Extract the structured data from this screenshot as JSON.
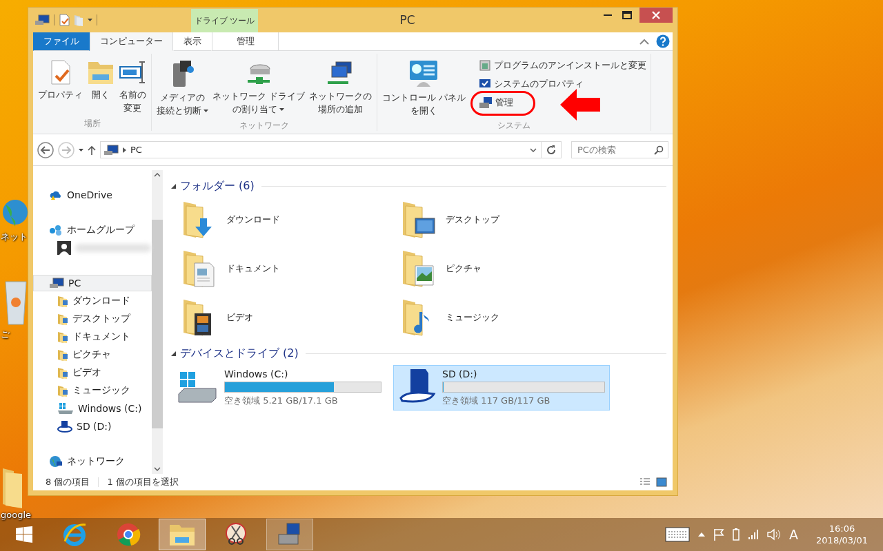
{
  "desktop_icons": [
    {
      "label": "ネット"
    },
    {
      "label": "ご"
    },
    {
      "label": "google"
    }
  ],
  "window": {
    "title": "PC",
    "contextual_group": "ドライブ ツール"
  },
  "tabs": [
    {
      "label": "ファイル",
      "kind": "file",
      "selected": false
    },
    {
      "label": "コンピューター",
      "kind": "normal",
      "selected": true
    },
    {
      "label": "表示",
      "kind": "normal",
      "selected": false
    },
    {
      "label": "管理",
      "kind": "contextual",
      "selected": false
    }
  ],
  "ribbon": {
    "groups": [
      {
        "label": "場所",
        "large": [
          {
            "lines": [
              "プロパティ"
            ],
            "dropdown": false
          },
          {
            "lines": [
              "開く"
            ],
            "dropdown": false
          },
          {
            "lines": [
              "名前の",
              "変更"
            ],
            "dropdown": false
          }
        ]
      },
      {
        "label": "ネットワーク",
        "large": [
          {
            "lines": [
              "メディアの",
              "接続と切断"
            ],
            "dropdown": true
          },
          {
            "lines": [
              "ネットワーク ドライブ",
              "の割り当て"
            ],
            "dropdown": true
          },
          {
            "lines": [
              "ネットワークの",
              "場所の追加"
            ],
            "dropdown": false
          }
        ]
      },
      {
        "label": "システム",
        "large": [
          {
            "lines": [
              "コントロール パネル",
              "を開く"
            ],
            "dropdown": false
          }
        ],
        "small": [
          {
            "label": "プログラムのアンインストールと変更",
            "highlighted": false
          },
          {
            "label": "システムのプロパティ",
            "highlighted": false
          },
          {
            "label": "管理",
            "highlighted": true
          }
        ]
      }
    ]
  },
  "address": {
    "path": "PC",
    "search_placeholder": "PCの検索"
  },
  "nav": {
    "items": [
      {
        "kind": "item",
        "label": "OneDrive",
        "selected": false
      },
      {
        "kind": "item",
        "label": "ホームグループ",
        "selected": false,
        "children": [
          {
            "kind": "user",
            "selected": false
          }
        ]
      },
      {
        "kind": "item",
        "label": "PC",
        "selected": true,
        "children": [
          {
            "kind": "item",
            "label": "ダウンロード",
            "selected": false
          },
          {
            "kind": "item",
            "label": "デスクトップ",
            "selected": false
          },
          {
            "kind": "item",
            "label": "ドキュメント",
            "selected": false
          },
          {
            "kind": "item",
            "label": "ピクチャ",
            "selected": false
          },
          {
            "kind": "item",
            "label": "ビデオ",
            "selected": false
          },
          {
            "kind": "item",
            "label": "ミュージック",
            "selected": false
          },
          {
            "kind": "item",
            "label": "Windows (C:)",
            "selected": false
          },
          {
            "kind": "item",
            "label": "SD (D:)",
            "selected": false
          }
        ]
      },
      {
        "kind": "item",
        "label": "ネットワーク",
        "selected": false
      }
    ]
  },
  "content": {
    "groups": [
      {
        "kind": "folders",
        "title": "フォルダー (6)",
        "expanded": true,
        "items": [
          {
            "label": "ダウンロード"
          },
          {
            "label": "デスクトップ"
          },
          {
            "label": "ドキュメント"
          },
          {
            "label": "ピクチャ"
          },
          {
            "label": "ビデオ"
          },
          {
            "label": "ミュージック"
          }
        ]
      },
      {
        "kind": "drives",
        "title": "デバイスとドライブ (2)",
        "expanded": true,
        "items": [
          {
            "label": "Windows (C:)",
            "level": 0.7,
            "free": "空き領域 5.21 GB/17.1 GB",
            "selected": false
          },
          {
            "label": "SD (D:)",
            "level": 0,
            "free": "空き領域 117 GB/117 GB",
            "selected": true
          }
        ]
      }
    ]
  },
  "status_bar": {
    "item_count": "8 個の項目",
    "selection": "1 個の項目を選択"
  },
  "taskbar": {
    "apps": [
      {
        "selected": false,
        "running": false
      },
      {
        "selected": false,
        "running": false
      },
      {
        "selected": true,
        "running": true
      },
      {
        "selected": false,
        "running": false
      },
      {
        "selected": false,
        "running": true
      }
    ],
    "ime": "A",
    "time": "16:06",
    "date": "2018/03/01"
  }
}
